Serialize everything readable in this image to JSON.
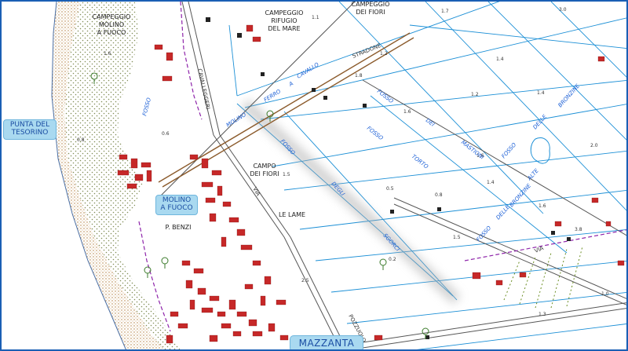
{
  "place_labels": {
    "campeggio_molino_l1": "CAMPEGGIO",
    "campeggio_molino_l2": "MOLINO",
    "campeggio_molino_l3": "A FUOCO",
    "campeggio_rifugio_l1": "CAMPEGGIO",
    "campeggio_rifugio_l2": "RIFUGIO",
    "campeggio_rifugio_l3": "DEL MARE",
    "campeggio_fiori_l1": "CAMPEGGIO",
    "campeggio_fiori_l2": "DEI FIORI",
    "campo_fiori_l1": "CAMPO",
    "campo_fiori_l2": "DEI FIORI",
    "le_lame": "LE LAME",
    "p_benzi": "P. BENZI"
  },
  "badges": {
    "punta_l1": "PUNTA DEL",
    "punta_l2": "TESORINO",
    "molino_l1": "MOLINO",
    "molino_l2": "A FUOCO",
    "mazzanta": "MAZZANTA"
  },
  "watercourse_labels": {
    "fosso_tutto": "FOSSO",
    "dei": "DEI",
    "mastioni": "MASTIONI",
    "fosso_delle": "FOSSO",
    "delle": "DELLE",
    "bronzine": "BRONZINE",
    "fosso_torto": "FOSSO",
    "torto": "TORTO",
    "fosso_bronzine_alte": "FOSSO",
    "delle2": "DELLE",
    "bronzine2": "BRONZINE",
    "alte": "ALTE",
    "fosso_sgorci": "FOSSO",
    "degli": "DEGLI",
    "sgorci": "SGORCI",
    "molino_ferro": "MOLINO",
    "ferro": "FERRO",
    "a": "A",
    "cavallo": "CAVALLO",
    "fosso_molino": "FOSSO"
  },
  "road_labels": {
    "cavalleggeri": "CAVALLEGGERI",
    "stradone": "STRADONE",
    "via": "VIA",
    "pozzuolo": "POZZUOLO",
    "via2": "VIA"
  },
  "spot_heights": [
    "1.6",
    "0.8",
    "1.1",
    "1.4",
    "1.2",
    "3.0",
    "1.7",
    "1.4",
    "1.6",
    "1.2",
    "1.6",
    "2.0",
    "0.5",
    "1.5",
    "0.8",
    "1.4",
    "1.6",
    "2.5",
    "0.2",
    "3.8",
    "1.3",
    "0.6",
    "1.0",
    "1.8",
    "1.5"
  ],
  "colors": {
    "map_frame": "#1a5fb4",
    "water": "#1b8fd6",
    "roads": "#555555",
    "road_main": "#8b5a2b",
    "buildings": "#c62828",
    "boundary": "#8e24aa",
    "dunes": "#d2b48c",
    "green_dots": "#6b8e23",
    "badge_fill": "#a9d9f0",
    "highlight": "#c8c8c8"
  }
}
